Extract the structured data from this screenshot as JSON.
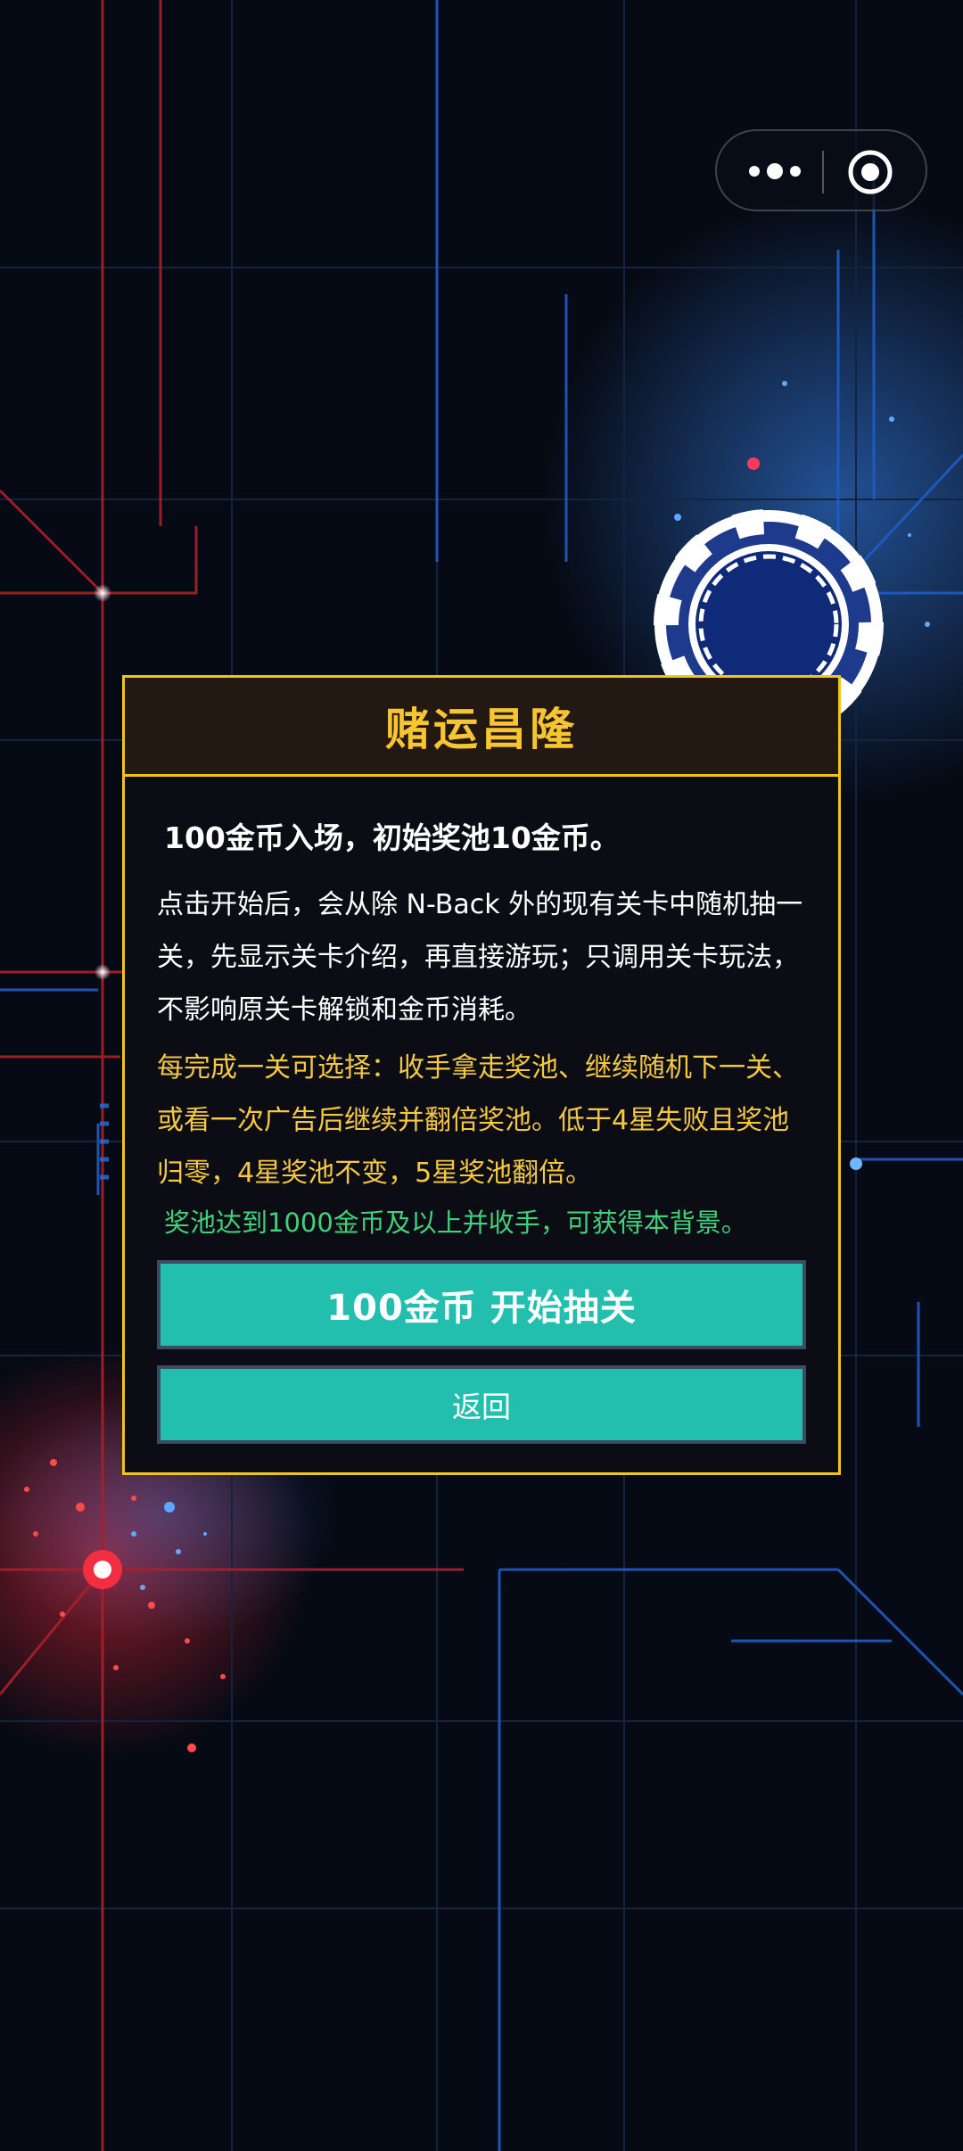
{
  "capsule": {
    "more_label": "•••",
    "close_label": "◎"
  },
  "dialog": {
    "title": "赌运昌隆",
    "headline": "100金币入场，初始奖池10金币。",
    "description": "点击开始后，会从除 N-Back 外的现有关卡中随机抽一关，先显示关卡介绍，再直接游玩；只调用关卡玩法，不影响原关卡解锁和金币消耗。",
    "rules": "每完成一关可选择：收手拿走奖池、继续随机下一关、或看一次广告后继续并翻倍奖池。低于4星失败且奖池归零，4星奖池不变，5星奖池翻倍。",
    "reward_note": "奖池达到1000金币及以上并收手，可获得本背景。",
    "start_button": "100金币 开始抽关",
    "back_button": "返回"
  },
  "colors": {
    "accent_border": "#f0c419",
    "title": "#f7c531",
    "rules_text": "#f5c842",
    "reward_text": "#3fd27a",
    "button": "#22bfae"
  },
  "icons": [
    "more-icon",
    "close-icon",
    "poker-chip-icon"
  ]
}
